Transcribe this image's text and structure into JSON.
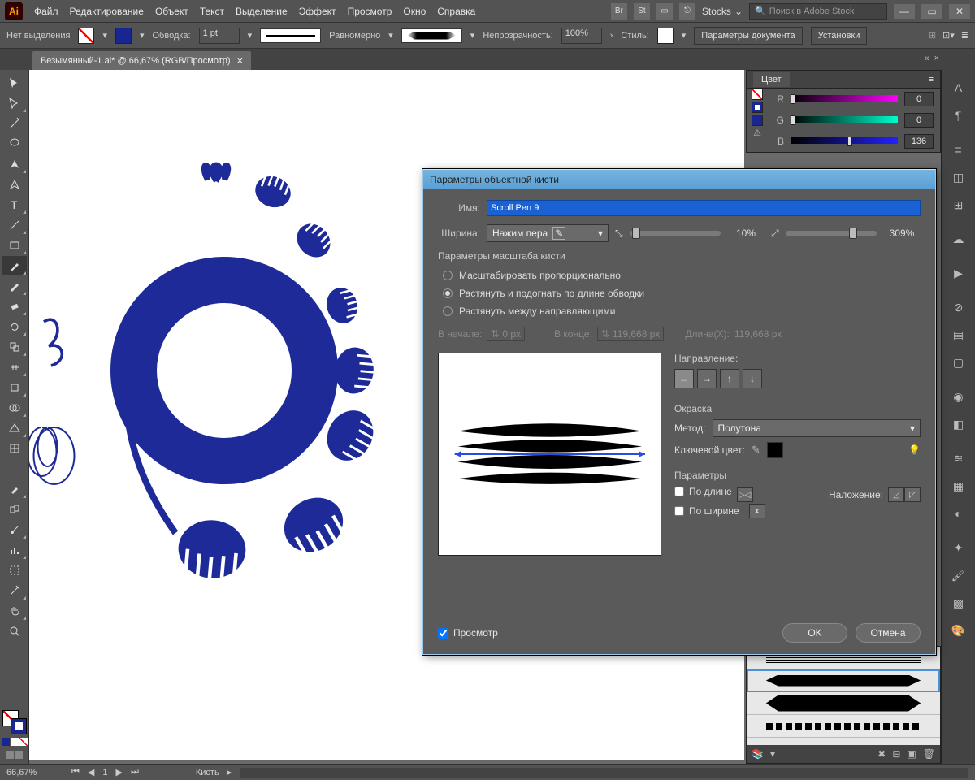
{
  "menu": {
    "file": "Файл",
    "edit": "Редактирование",
    "object": "Объект",
    "text": "Текст",
    "select": "Выделение",
    "effect": "Эффект",
    "view": "Просмотр",
    "window": "Окно",
    "help": "Справка",
    "stocks": "Stocks",
    "search_placeholder": "Поиск в Adobe Stock"
  },
  "control": {
    "nosel": "Нет выделения",
    "stroke": "Обводка:",
    "stroke_pt": "1 pt",
    "uniform": "Равномерно",
    "opacity_label": "Непрозрачность:",
    "opacity": "100%",
    "style": "Стиль:",
    "docparams": "Параметры документа",
    "setup": "Установки"
  },
  "doc_tab": "Безымянный-1.ai* @ 66,67% (RGB/Просмотр)",
  "color": {
    "panel": "Цвет",
    "r": "R",
    "g": "G",
    "b": "B",
    "rv": "0",
    "gv": "0",
    "bv": "136"
  },
  "dialog": {
    "title": "Параметры объектной кисти",
    "name_label": "Имя:",
    "name": "Scroll Pen 9",
    "width_label": "Ширина:",
    "width_mode": "Нажим пера",
    "min": "10%",
    "max": "309%",
    "scale_title": "Параметры масштаба кисти",
    "opt1": "Масштабировать пропорционально",
    "opt2": "Растянуть и подогнать по длине обводки",
    "opt3": "Растянуть между направляющими",
    "start": "В начале:",
    "start_v": "0 px",
    "end": "В конце:",
    "end_v": "119,668 px",
    "lenx": "Длина(X):",
    "lenx_v": "119,668 px",
    "direction": "Направление:",
    "tint": "Окраска",
    "method": "Метод:",
    "method_v": "Полутона",
    "keycolor": "Ключевой цвет:",
    "params": "Параметры",
    "bylen": "По длине",
    "bywidth": "По ширине",
    "overlay": "Наложение:",
    "preview": "Просмотр",
    "ok": "OK",
    "cancel": "Отмена"
  },
  "status": {
    "zoom": "66,67%",
    "tool": "Кисть"
  }
}
